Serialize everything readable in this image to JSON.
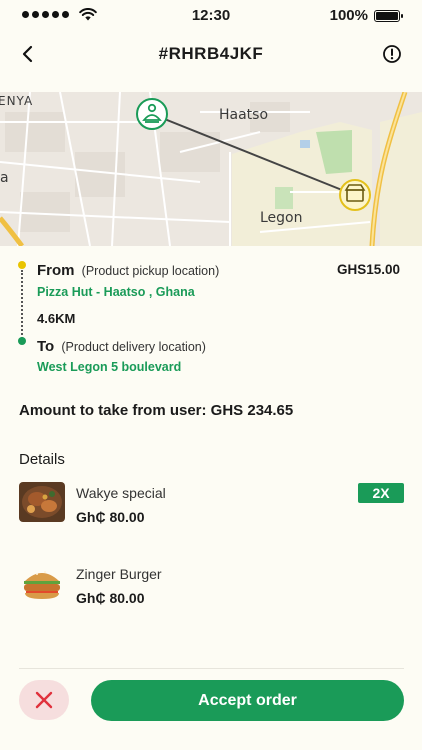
{
  "status_bar": {
    "time": "12:30",
    "battery": "100%"
  },
  "header": {
    "title": "#RHRB4JKF"
  },
  "map": {
    "labels": [
      "ENYA",
      "Haatso",
      "a",
      "Legon"
    ]
  },
  "route": {
    "from_label": "From",
    "from_hint": "(Product pickup location)",
    "from_place": "Pizza Hut - Haatso , Ghana",
    "price": "GHS15.00",
    "distance": "4.6KM",
    "to_label": "To",
    "to_hint": "(Product delivery location)",
    "to_place": "West Legon 5 boulevard"
  },
  "amount_text": "Amount to take from user: GHS 234.65",
  "details_title": "Details",
  "items": [
    {
      "name": "Wakye special",
      "price": "Gh₵ 80.00",
      "qty": "2X"
    },
    {
      "name": "Zinger Burger",
      "price": "Gh₵ 80.00"
    }
  ],
  "actions": {
    "accept_label": "Accept order"
  },
  "colors": {
    "accent": "#1a9b58",
    "reject_bg": "#f6dede",
    "reject_icon": "#e0313c",
    "pickup_dot": "#e9c400"
  },
  "icons": {
    "back": "chevron-left-icon",
    "info": "info-icon",
    "pickup_marker": "pickup-marker-icon",
    "delivery_marker": "store-marker-icon",
    "reject": "close-icon"
  }
}
